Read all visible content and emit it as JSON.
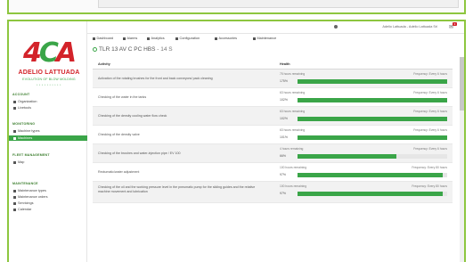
{
  "brand": {
    "mark_left": "4",
    "mark_middle": "C",
    "mark_right": "A",
    "name": "ADELIO LATTUADA",
    "tagline": "EVOLUTION OF BLOW MOLDING",
    "dots": "• • • • • • • • • •"
  },
  "sidebar": {
    "sections": [
      {
        "title": "ACCOUNT",
        "items": [
          {
            "label": "Organization",
            "icon": "building-icon"
          },
          {
            "label": "Livetools",
            "icon": "search-icon"
          }
        ]
      },
      {
        "title": "MONITORING",
        "items": [
          {
            "label": "Machine types",
            "icon": "clock-icon"
          },
          {
            "label": "Machines",
            "icon": "gear-icon",
            "active": true
          }
        ]
      },
      {
        "title": "FLEET MANAGEMENT",
        "items": [
          {
            "label": "Map",
            "icon": "map-icon"
          }
        ]
      },
      {
        "title": "MAINTENANCE",
        "items": [
          {
            "label": "Maintenance types",
            "icon": "wrench-icon"
          },
          {
            "label": "Maintenance orders",
            "icon": "list-icon"
          },
          {
            "label": "Servicings",
            "icon": "tools-icon"
          },
          {
            "label": "Calendar",
            "icon": "calendar-icon"
          }
        ]
      }
    ]
  },
  "topbar": {
    "user": "Adelio Lattuada - Adelio Lattuada Srl",
    "bell_count": "3"
  },
  "menu": {
    "items": [
      {
        "label": "Dashboard",
        "icon": "dashboard-icon"
      },
      {
        "label": "Alarms",
        "icon": "alarm-icon"
      },
      {
        "label": "Analytics",
        "icon": "chart-icon"
      },
      {
        "label": "Configuration",
        "icon": "config-icon"
      },
      {
        "label": "Accessories",
        "icon": "accessories-icon"
      },
      {
        "label": "Maintenance",
        "icon": "wrench-icon"
      }
    ]
  },
  "page": {
    "title": "TLR 13 AV C PC HBS",
    "title_suffix": "- 14 S"
  },
  "table": {
    "headers": {
      "activity": "Activity",
      "health": "Health"
    },
    "rows": [
      {
        "activity": "Activation of the rotating brushes for the front and back conveyors/ pack cleaning",
        "remaining": "75 hours remaining",
        "frequency": "Frequency: Every 6 hours",
        "pct": "175%",
        "fill": 1.0
      },
      {
        "activity": "Checking of the water in the tanks",
        "remaining": "63 hours remaining",
        "frequency": "Frequency: Every 6 hours",
        "pct": "102%",
        "fill": 1.0
      },
      {
        "activity": "Checking of the density cooling water flow check",
        "remaining": "63 hours remaining",
        "frequency": "Frequency: Every 6 hours",
        "pct": "102%",
        "fill": 1.0
      },
      {
        "activity": "Checking of the density valve",
        "remaining": "63 hours remaining",
        "frequency": "Frequency: Every 6 hours",
        "pct": "101%",
        "fill": 1.0
      },
      {
        "activity": "Checking of the brushes and water-injection pipe / EV 100",
        "remaining": "4 hours remaining",
        "frequency": "Frequency: Every 6 hours",
        "pct": "66%",
        "fill": 0.66
      },
      {
        "activity": "Rectumatic/water adjustment",
        "remaining": "100 hours remaining",
        "frequency": "Frequency: Every 80 hours",
        "pct": "97%",
        "fill": 0.97
      },
      {
        "activity": "Checking of the oil and the working pressure level in the pneumatic pump for the sliding guides and the relative machine movement and lubrication",
        "remaining": "100 hours remaining",
        "frequency": "Frequency: Every 80 hours",
        "pct": "97%",
        "fill": 0.97
      }
    ]
  },
  "colors": {
    "accent": "#3aa548",
    "brand_red": "#d3232a",
    "frame": "#8dc63f"
  }
}
